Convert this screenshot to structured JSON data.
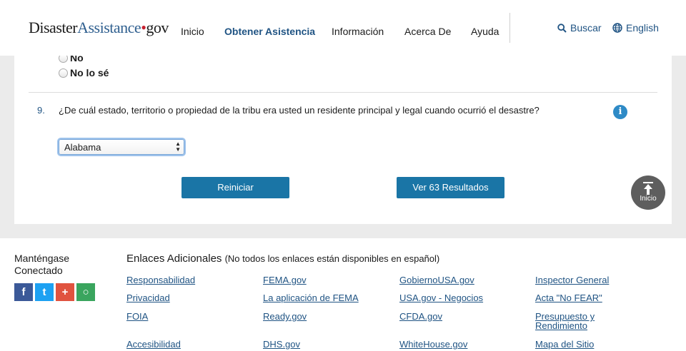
{
  "header": {
    "logo": {
      "part1": "Disaster",
      "part2": "Assistance",
      "dot": "•",
      "part3": "gov"
    },
    "nav": [
      {
        "label": "Inicio",
        "active": false
      },
      {
        "label": "Obtener Asistencia",
        "active": true
      },
      {
        "label": "Información",
        "active": false
      },
      {
        "label": "Acerca De",
        "active": false
      },
      {
        "label": "Ayuda",
        "active": false
      }
    ],
    "search_label": "Buscar",
    "language_label": "English"
  },
  "question8": {
    "options": [
      "No",
      "No lo sé"
    ]
  },
  "question9": {
    "number": "9.",
    "text": "¿De cuál estado, territorio o propiedad de la tribu era usted un residente principal y legal cuando ocurrió el desastre?",
    "selected_value": "Alabama",
    "info_symbol": "i"
  },
  "buttons": {
    "reset": "Reiniciar",
    "results": "Ver 63 Resultados",
    "back_to_top": "Inicio"
  },
  "footer": {
    "stay_connected": "Manténgase Conectado",
    "social": [
      "f",
      "t",
      "+",
      "○"
    ],
    "links_title": "Enlaces Adicionales",
    "links_note": "(No todos los enlaces están disponibles en español)",
    "columns": [
      [
        "Responsabilidad",
        "Privacidad",
        "FOIA",
        "Accesibilidad"
      ],
      [
        "FEMA.gov",
        "La aplicación de FEMA",
        "Ready.gov",
        "DHS.gov"
      ],
      [
        "GobiernoUSA.gov",
        "USA.gov - Negocios",
        "CFDA.gov",
        "WhiteHouse.gov"
      ],
      [
        "Inspector General",
        "Acta \"No FEAR\"",
        "Presupuesto y Rendimiento",
        "Mapa del Sitio"
      ]
    ]
  },
  "colors": {
    "accent": "#1f5383",
    "button": "#1a75a6",
    "logo_dot": "#c7202f",
    "page_bg": "#ebebeb"
  }
}
